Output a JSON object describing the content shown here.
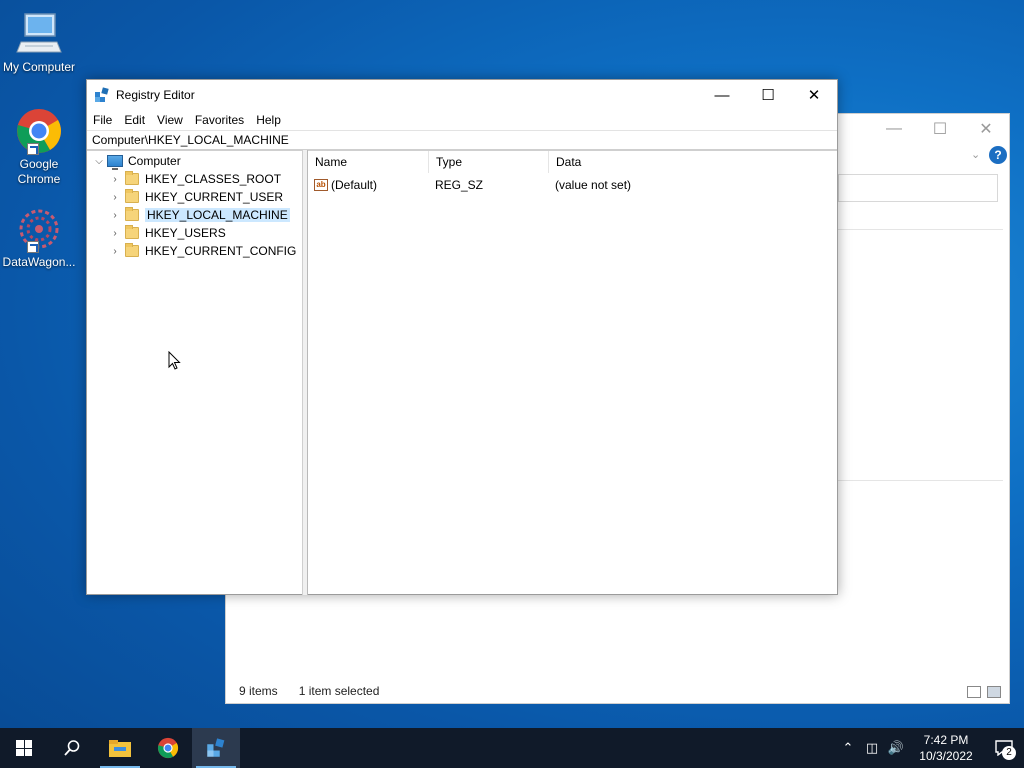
{
  "desktop": {
    "icons": [
      {
        "label": "My Computer"
      },
      {
        "label": "Google Chrome"
      },
      {
        "label": "DataWagon..."
      }
    ]
  },
  "background_window": {
    "status_items": "9 items",
    "status_selected": "1 item selected"
  },
  "regedit": {
    "title": "Registry Editor",
    "menu": [
      "File",
      "Edit",
      "View",
      "Favorites",
      "Help"
    ],
    "address": "Computer\\HKEY_LOCAL_MACHINE",
    "tree": {
      "root": "Computer",
      "children": [
        {
          "label": "HKEY_CLASSES_ROOT",
          "selected": false
        },
        {
          "label": "HKEY_CURRENT_USER",
          "selected": false
        },
        {
          "label": "HKEY_LOCAL_MACHINE",
          "selected": true
        },
        {
          "label": "HKEY_USERS",
          "selected": false
        },
        {
          "label": "HKEY_CURRENT_CONFIG",
          "selected": false
        }
      ]
    },
    "columns": [
      "Name",
      "Type",
      "Data"
    ],
    "values": [
      {
        "name": "(Default)",
        "type": "REG_SZ",
        "data": "(value not set)"
      }
    ]
  },
  "taskbar": {
    "clock_time": "7:42 PM",
    "clock_date": "10/3/2022",
    "notification_count": "2"
  },
  "colors": {
    "selection": "#cce8ff",
    "taskbar": "#101a29",
    "accent": "#76b9ed"
  }
}
